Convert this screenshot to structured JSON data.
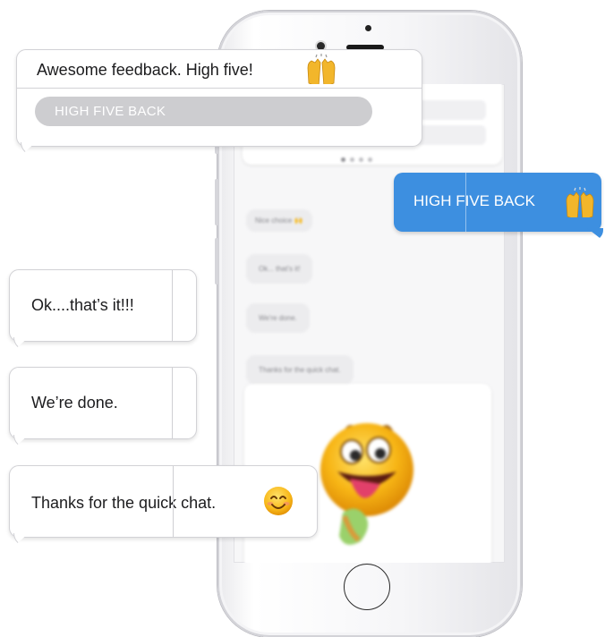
{
  "screen": {
    "blurred_messages": [
      "Nice choice 🙌",
      "Ok... that's it!",
      "We're done.",
      "Thanks for the quick chat."
    ]
  },
  "bubbles": {
    "awesome": {
      "text": "Awesome feedback. High five!",
      "emoji": "raising-hands-emoji",
      "action_label": "HIGH FIVE BACK"
    },
    "reply": {
      "text": "HIGH FIVE BACK",
      "emoji": "raising-hands-emoji",
      "color": "#3d8fe0"
    },
    "ok": {
      "text": "Ok....that’s it!!!"
    },
    "done": {
      "text": "We’re done."
    },
    "thanks": {
      "text": "Thanks for the quick chat.",
      "emoji": "smiling-face-emoji"
    }
  },
  "colors": {
    "user_bubble": "#3d8fe0",
    "bot_bubble": "#ffffff",
    "quick_reply": "#cdcdd0"
  }
}
